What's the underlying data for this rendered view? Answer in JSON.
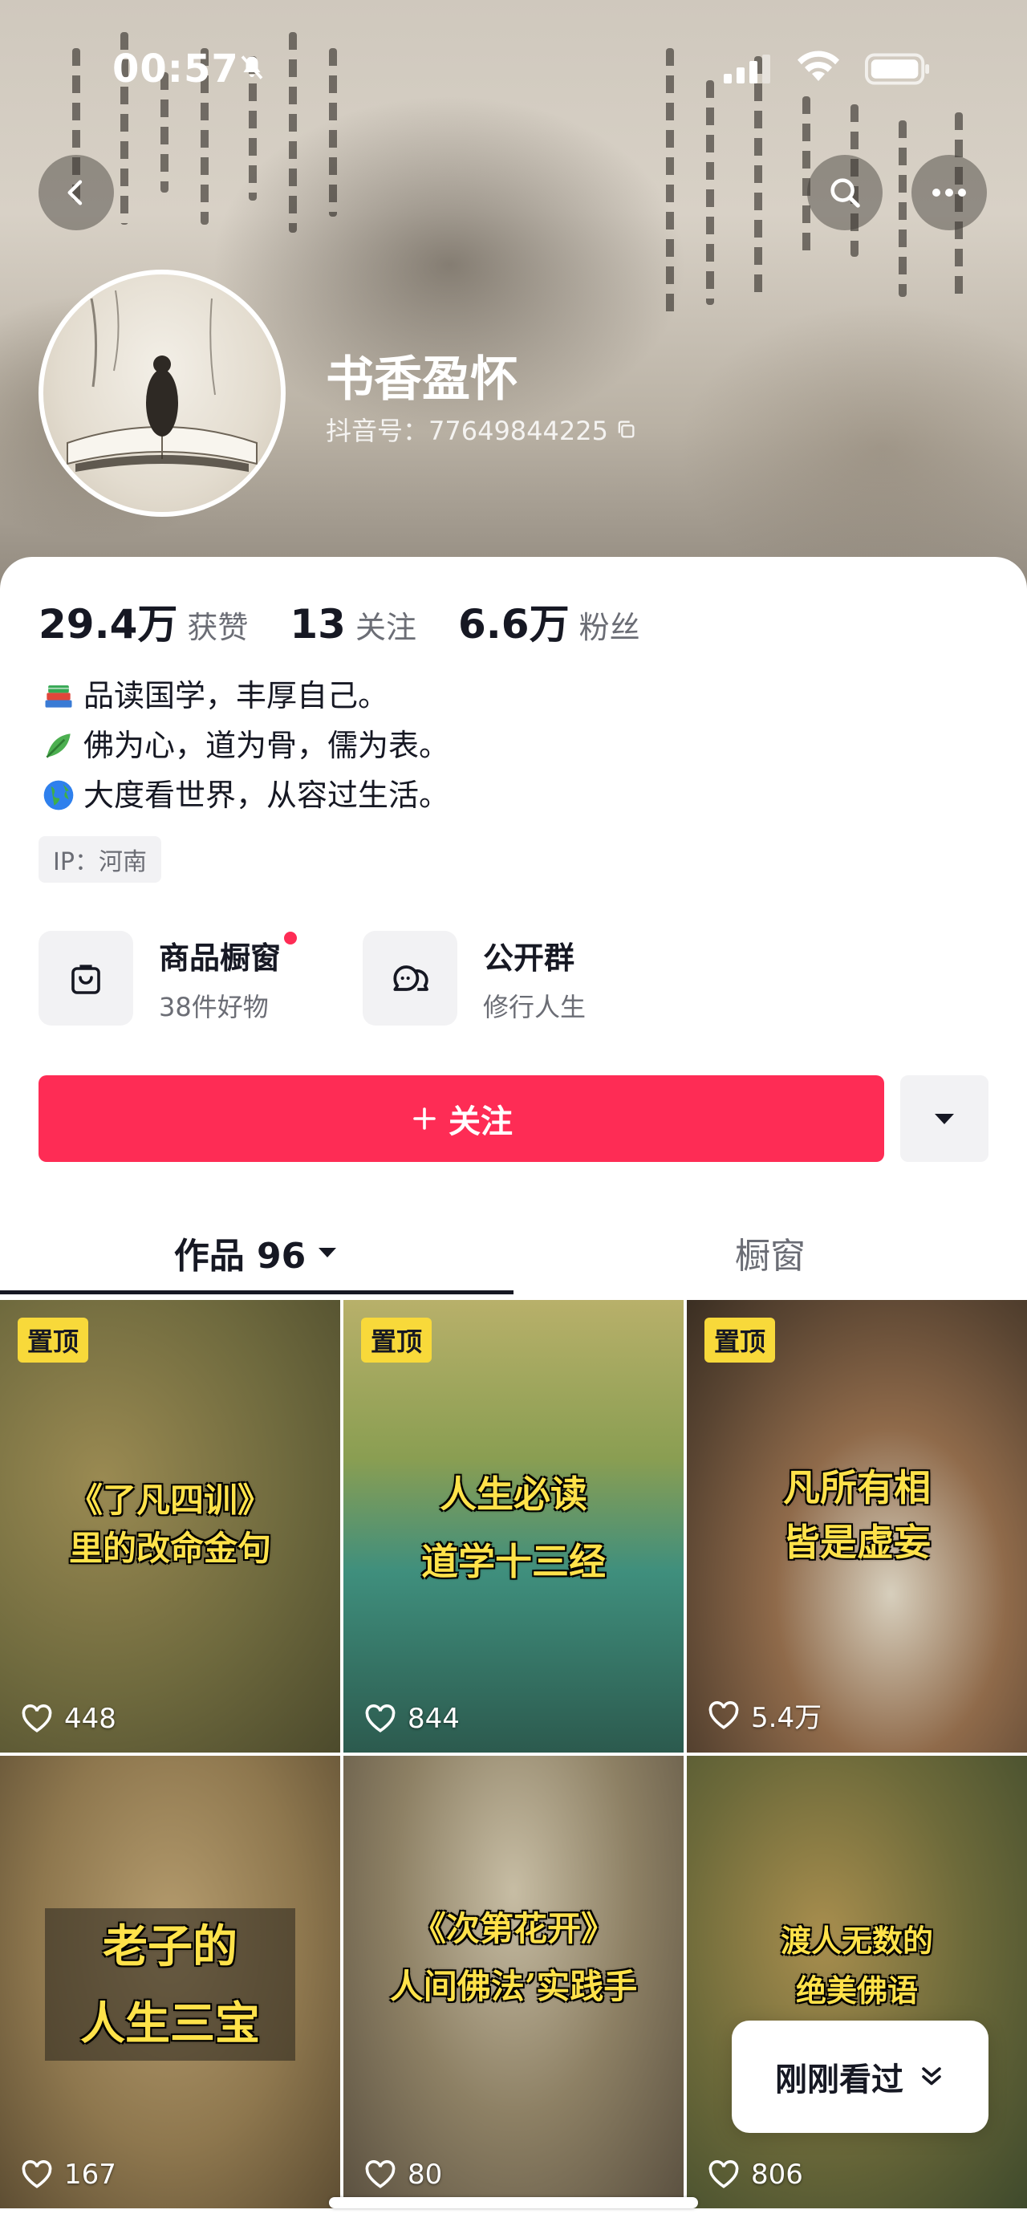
{
  "status_bar": {
    "time": "00:57"
  },
  "profile": {
    "nickname": "书香盈怀",
    "douyin_id": "抖音号：77649844225"
  },
  "stats": [
    {
      "value": "29.4万",
      "label": "获赞"
    },
    {
      "value": "13",
      "label": "关注"
    },
    {
      "value": "6.6万",
      "label": "粉丝"
    }
  ],
  "bio": [
    {
      "icon": "books-icon",
      "text": "品读国学，丰厚自己。"
    },
    {
      "icon": "leaf-icon",
      "text": "佛为心，道为骨，儒为表。"
    },
    {
      "icon": "globe-icon",
      "text": "大度看世界，从容过生活。"
    }
  ],
  "ip": "IP：河南",
  "entries": {
    "shop": {
      "title": "商品橱窗",
      "subtitle": "38件好物"
    },
    "group": {
      "title": "公开群",
      "subtitle": "修行人生"
    }
  },
  "follow_label": "关注",
  "tabs": {
    "works": "作品 96",
    "shop": "橱窗"
  },
  "pin_label": "置顶",
  "videos": [
    {
      "title": [
        "《了凡四训》",
        "里的改命金句"
      ],
      "likes": "448",
      "pinned": true
    },
    {
      "title": [
        "人生必读",
        "道学十三经"
      ],
      "likes": "844",
      "pinned": true
    },
    {
      "title": [
        "凡所有相",
        "皆是虚妄"
      ],
      "likes": "5.4万",
      "pinned": true
    },
    {
      "title": [
        "老子的",
        "人生三宝"
      ],
      "likes": "167",
      "pinned": false
    },
    {
      "title": [
        "《次第花开》",
        "人间佛法’实践手"
      ],
      "likes": "80",
      "pinned": false
    },
    {
      "title": [
        "渡人无数的",
        "绝美佛语"
      ],
      "likes": "806",
      "pinned": false
    }
  ],
  "recent_label": "刚刚看过",
  "colors": {
    "accent": "#fe2c55",
    "pin": "#f8d93a",
    "title_yellow": "#ffe24a"
  }
}
